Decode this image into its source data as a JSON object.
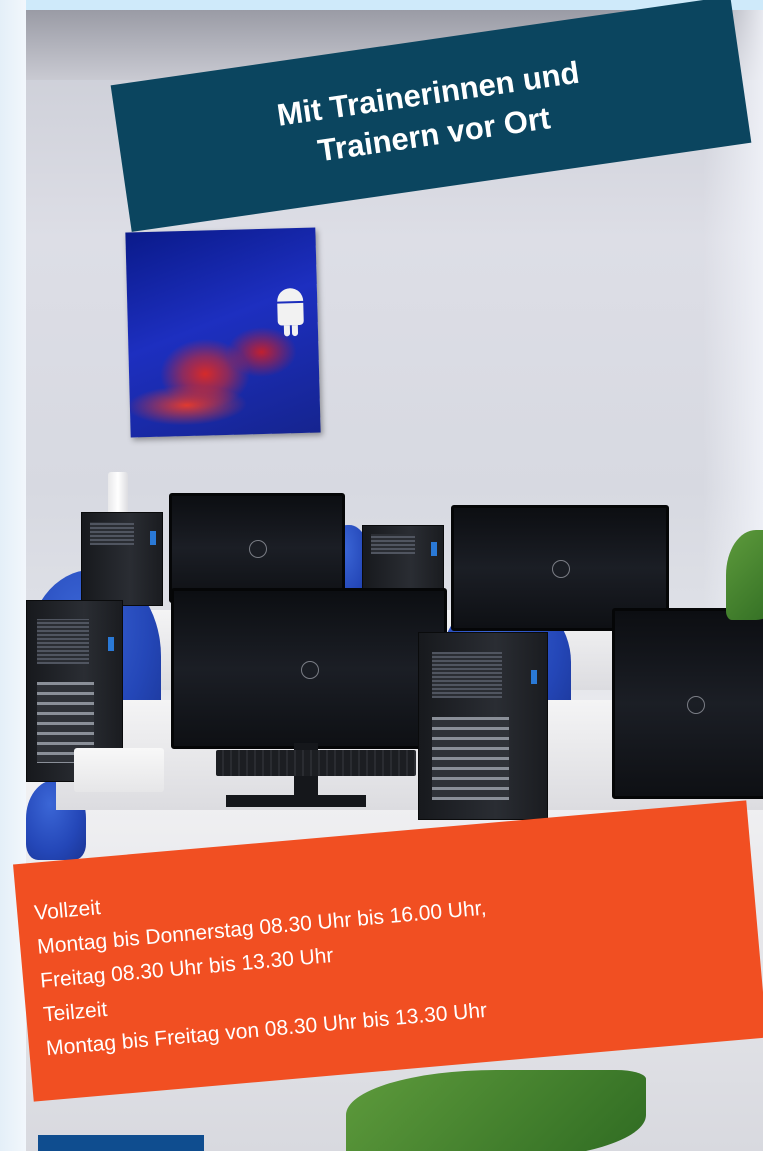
{
  "headline": {
    "line1": "Mit Trainerinnen und",
    "line2": "Trainern vor Ort"
  },
  "schedule": {
    "vollzeit_label": "Vollzeit",
    "vollzeit_line1": "Montag bis Donnerstag 08.30 Uhr bis 16.00 Uhr,",
    "vollzeit_line2": "Freitag 08.30 Uhr bis 13.30 Uhr",
    "teilzeit_label": "Teilzeit",
    "teilzeit_line1": "Montag bis Freitag von 08.30 Uhr bis 13.30 Uhr"
  },
  "colors": {
    "headline_bg": "#0b455f",
    "schedule_bg": "#f14f22",
    "button_bg": "#0f4d8f"
  }
}
